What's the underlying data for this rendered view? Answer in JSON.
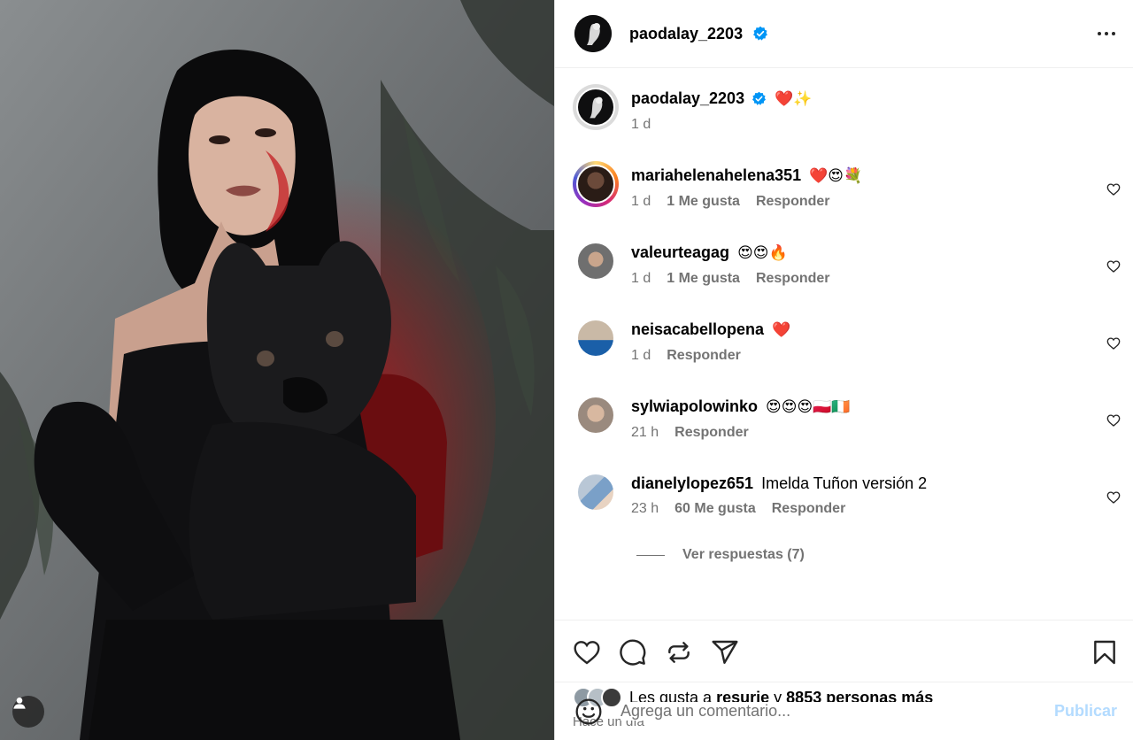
{
  "post": {
    "author": "paodalay_2203",
    "caption": "❤️✨",
    "caption_time": "1 d"
  },
  "comments": [
    {
      "user": "mariahelenahelena351",
      "text": "❤️😍💐",
      "time": "1 d",
      "likes": "1 Me gusta",
      "reply": "Responder"
    },
    {
      "user": "valeurteagag",
      "text": "😍😍🔥",
      "time": "1 d",
      "likes": "1 Me gusta",
      "reply": "Responder"
    },
    {
      "user": "neisacabellopena",
      "text": "❤️",
      "time": "1 d",
      "likes": "",
      "reply": "Responder"
    },
    {
      "user": "sylwiapolowinko",
      "text": "😍😍😍🇵🇱🇮🇪",
      "time": "21 h",
      "likes": "",
      "reply": "Responder"
    },
    {
      "user": "dianelylopez651",
      "text": "Imelda Tuñon versión 2",
      "time": "23 h",
      "likes": "60 Me gusta",
      "reply": "Responder"
    }
  ],
  "view_replies": "Ver respuestas (7)",
  "likes": {
    "prefix": "Les gusta a",
    "user": "resurie",
    "connector": "y",
    "others": "8853 personas más"
  },
  "time_ago": "Hace un día",
  "add_comment": {
    "placeholder": "Agrega un comentario...",
    "publish": "Publicar"
  },
  "colors": {
    "verified": "#0095f6",
    "publish_disabled": "#b3dbff",
    "secondary_text": "#737373"
  }
}
